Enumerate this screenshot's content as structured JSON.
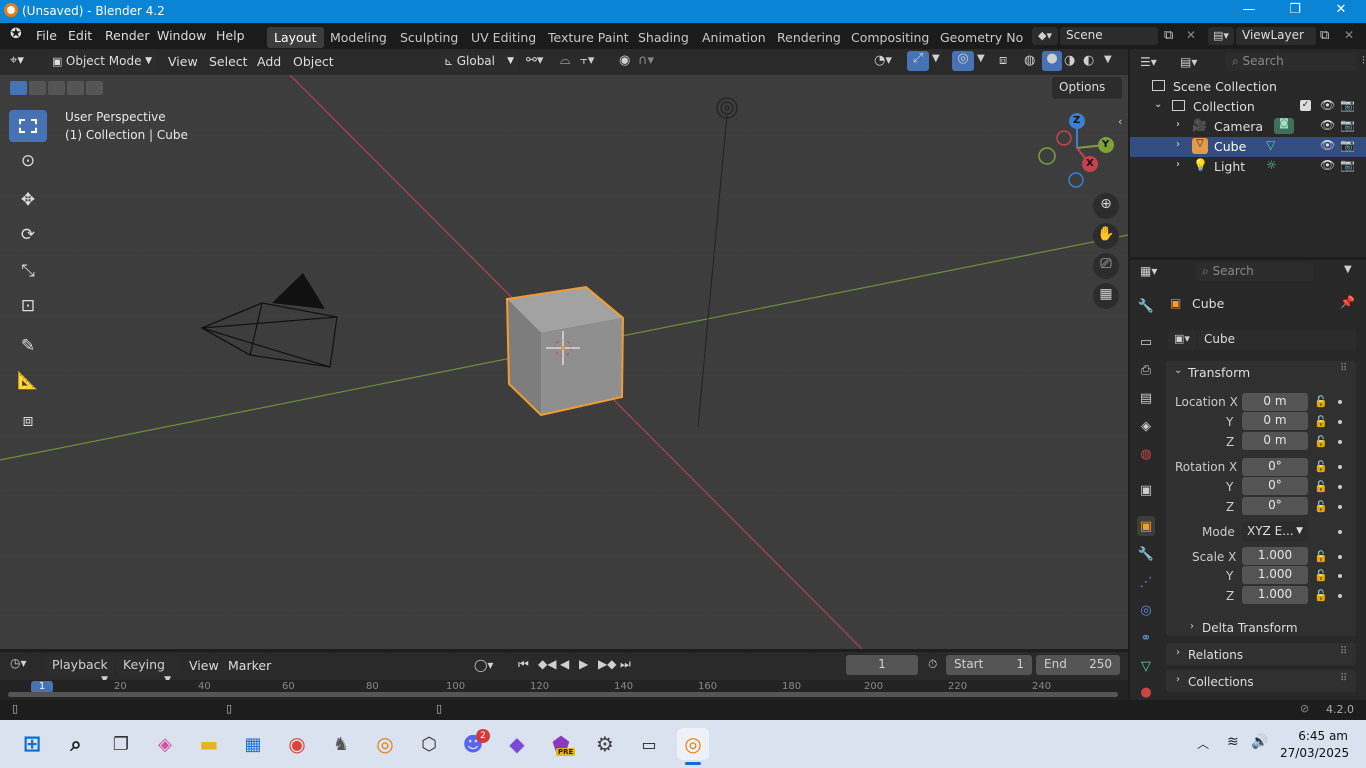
{
  "titlebar": {
    "title": "(Unsaved) - Blender 4.2",
    "minimize": "—",
    "maximize": "❐",
    "close": "✕"
  },
  "menu": {
    "file": "File",
    "edit": "Edit",
    "render": "Render",
    "window": "Window",
    "help": "Help"
  },
  "workspaces": [
    "Layout",
    "Modeling",
    "Sculpting",
    "UV Editing",
    "Texture Paint",
    "Shading",
    "Animation",
    "Rendering",
    "Compositing",
    "Geometry Node"
  ],
  "active_workspace": "Layout",
  "scene": {
    "name": "Scene",
    "view_layer": "ViewLayer"
  },
  "viewport_header": {
    "mode": "Object Mode",
    "view": "View",
    "select": "Select",
    "add": "Add",
    "object": "Object",
    "orientation": "Global",
    "options": "Options"
  },
  "viewport": {
    "perspective": "User Perspective",
    "collection_info": "(1) Collection | Cube",
    "gizmo_x": "X",
    "gizmo_y": "Y",
    "gizmo_z": "Z"
  },
  "outliner": {
    "search_placeholder": "Search",
    "scene_collection": "Scene Collection",
    "collection": "Collection",
    "items": [
      {
        "name": "Camera"
      },
      {
        "name": "Cube"
      },
      {
        "name": "Light"
      }
    ],
    "selected": "Cube"
  },
  "properties": {
    "search_placeholder": "Search",
    "object_name": "Cube",
    "datablock": "Cube",
    "transform_header": "Transform",
    "location_label": "Location X",
    "y_label": "Y",
    "z_label": "Z",
    "location": [
      "0 m",
      "0 m",
      "0 m"
    ],
    "rotation_label": "Rotation X",
    "rotation": [
      "0°",
      "0°",
      "0°"
    ],
    "mode_label": "Mode",
    "mode_value": "XYZ E...",
    "scale_label": "Scale X",
    "scale": [
      "1.000",
      "1.000",
      "1.000"
    ],
    "delta_transform": "Delta Transform",
    "relations": "Relations",
    "collections": "Collections"
  },
  "timeline": {
    "playback": "Playback",
    "keying": "Keying",
    "view": "View",
    "marker": "Marker",
    "current_frame": "1",
    "start_label": "Start",
    "start": "1",
    "end_label": "End",
    "end": "250",
    "ticks": [
      "1",
      "20",
      "40",
      "60",
      "80",
      "100",
      "120",
      "140",
      "160",
      "180",
      "200",
      "220",
      "240"
    ]
  },
  "statusbar": {
    "version": "4.2.0"
  },
  "taskbar": {
    "time": "6:45 am",
    "date": "27/03/2025",
    "discord_badge": "2",
    "affinity_badge": "PRE"
  },
  "colors": {
    "titlebar": "#0a84d4",
    "selection": "#4772b3",
    "object_outline": "#f29c30",
    "x_axis": "#c8424d",
    "y_axis": "#7ca33a",
    "z_axis": "#3c7dd6"
  }
}
